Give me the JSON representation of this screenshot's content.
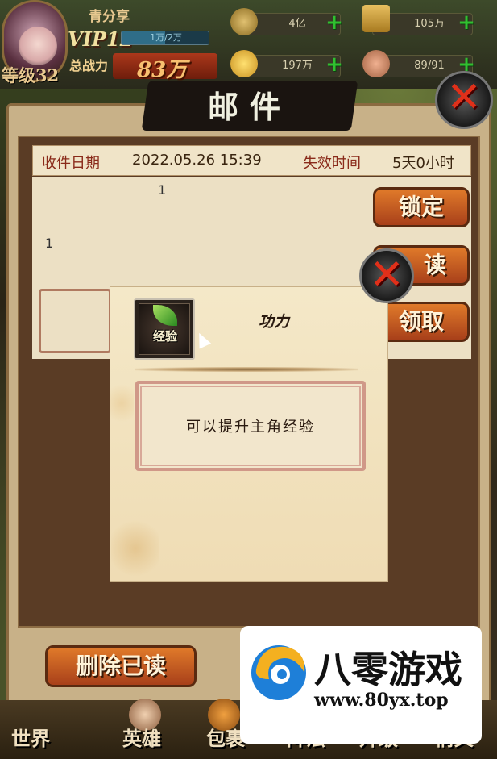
{
  "hud": {
    "player_name": "青分享",
    "vip": "VIP12",
    "vip_progress_text": "1万/2万",
    "vip_progress": 0.5,
    "level": "等级32",
    "power_label": "总战力",
    "power_value": "83万"
  },
  "resources": [
    {
      "icon": "copper-coin-icon",
      "value": "4亿"
    },
    {
      "icon": "scroll-icon",
      "value": "105万"
    },
    {
      "icon": "gold-ingot-icon",
      "value": "197万"
    },
    {
      "icon": "muscle-arm-icon",
      "value": "89/91"
    }
  ],
  "mail": {
    "title": "邮件",
    "received_label": "收件日期",
    "received_value": "2022.05.26 15:39",
    "expire_label": "失效时间",
    "expire_value": "5天0小时",
    "body_line1": "1",
    "body_line2": "1",
    "lock_label": "锁定",
    "read_label": "读",
    "claim_label": "领取",
    "delete_read_label": "删除已读"
  },
  "popup": {
    "item_tag": "经验",
    "title": "功力",
    "description": "可以提升主角经验"
  },
  "nav": [
    {
      "label": "世界"
    },
    {
      "label": "英雄"
    },
    {
      "label": "包裹"
    },
    {
      "label": "阵法"
    },
    {
      "label": "升级"
    },
    {
      "label": "情义"
    }
  ],
  "watermark": {
    "name": "八零游戏",
    "url": "www.80yx.top"
  },
  "colors": {
    "accent": "#e07a2a",
    "close_red": "#e0301a",
    "plus_green": "#30c030",
    "label_red": "#8a2a1a"
  }
}
